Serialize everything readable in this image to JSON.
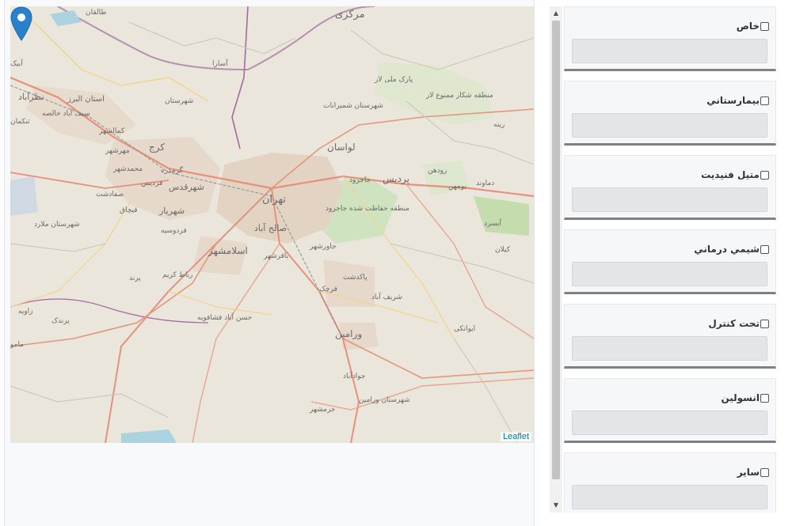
{
  "map": {
    "attribution": "Leaflet",
    "marker_icon": "map-pin-icon",
    "labels": {
      "markazi": "مرکزی",
      "taleqan": "طالقان",
      "abyek": "آبیک",
      "nazarabad": "نظرآباد",
      "ostan_alborz": "استان البرز",
      "saifabad": "سیف آباد خالصه",
      "tankaman": "تنکمان",
      "kamalshahr": "کمالشهر",
      "mehrshahr": "مهرشهر",
      "karaj": "کرج",
      "mohammadshahr": "محمدشهر",
      "garmdareh": "گرمدره",
      "shahrestan_karaj": "شهرستان",
      "asara": "آسارا",
      "shahrestan_shemiranat": "شهرستان شمیرانات",
      "park_melli": "پارک ملی لار",
      "mantaghe_shekar": "منطقه شکار ممنوع لار",
      "lavasan": "لواسان",
      "tehran": "تهران",
      "shahrgods": "شهرقدس",
      "ferdis": "فردیس",
      "safadasht": "صفادشت",
      "shahriar": "شهریار",
      "fardis2": "فردوسیه",
      "qeshlaq": "قیچاق",
      "shahrestan_malard": "شهرستان ملارد",
      "eslamshahr": "اسلامشهر",
      "baghershahr": "باقرشهر",
      "salehabad": "صالح آباد",
      "robat_karim": "رباط کریم",
      "parand": "پرند",
      "jajrud": "جاجرود",
      "pardis": "پردیس",
      "mantaghe_hefazat": "منطقه حفاظت شده جاجرود",
      "rudehen": "رودهن",
      "boumehen": "بومهن",
      "absard": "آبسرد",
      "damavand": "دماوند",
      "kilan": "کیلان",
      "rineh": "رینه",
      "javadabad_east": "جاورشهر",
      "pakdasht": "پاکدشت",
      "qarchak": "قرچک",
      "sharifabad": "شریف آباد",
      "ivanaki": "ایوانکی",
      "varamin": "ورامین",
      "javadabad": "جوادآباد",
      "shahrestan_varamin": "شهرستان ورامین",
      "pishva": "جرمشهر",
      "hasanabad": "حسن آباد فشافویه",
      "zaviyeh": "زاویه",
      "parandak": "پرندک",
      "mamu": "مامو"
    }
  },
  "items": [
    {
      "label": "خاص",
      "value": ""
    },
    {
      "label": "بيمارستاني",
      "value": ""
    },
    {
      "label": "متيل فنيديت",
      "value": ""
    },
    {
      "label": "شيمي درماني",
      "value": ""
    },
    {
      "label": "تحت كنترل",
      "value": ""
    },
    {
      "label": "انسولين",
      "value": ""
    },
    {
      "label": "ساير",
      "value": ""
    }
  ]
}
